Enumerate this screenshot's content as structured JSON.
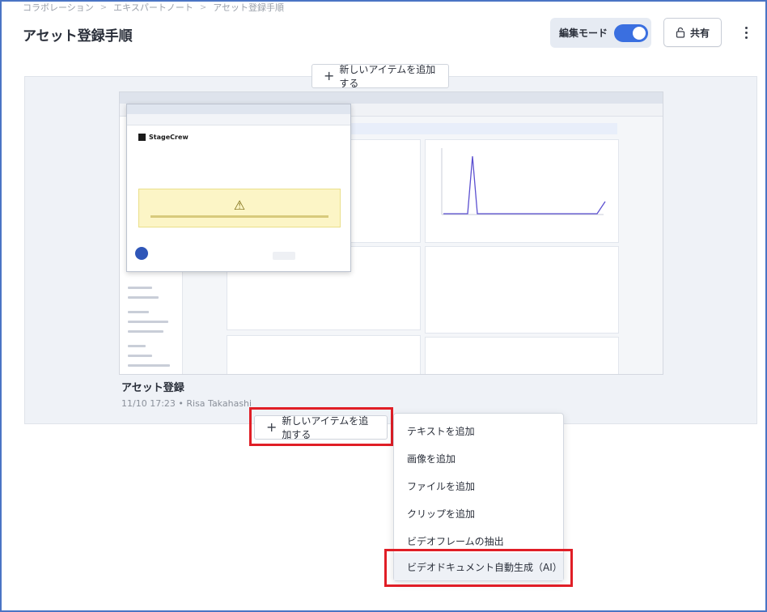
{
  "breadcrumb": [
    "コラボレーション",
    "エキスパートノート",
    "アセット登録手順"
  ],
  "page": {
    "title": "アセット登録手順"
  },
  "header": {
    "edit_mode_label": "編集モード",
    "edit_mode_on": true,
    "share_label": "共有",
    "more_icon": "more-vertical-icon",
    "share_icon": "lock-icon"
  },
  "add_item": {
    "label": "新しいアイテムを追加する",
    "icon": "plus-icon"
  },
  "asset": {
    "title": "アセット登録",
    "meta": "11/10 17:23 • Risa Takahashi"
  },
  "embedded": {
    "brand": "StageCrew",
    "warning_icon": "warning-icon"
  },
  "menu": {
    "items": [
      "テキストを追加",
      "画像を追加",
      "ファイルを追加",
      "クリップを追加",
      "ビデオフレームの抽出",
      "ビデオドキュメント自動生成（AI）"
    ]
  },
  "colors": {
    "accent": "#3a6fe0",
    "highlight": "#e01e26",
    "frame": "#4a74c4"
  }
}
